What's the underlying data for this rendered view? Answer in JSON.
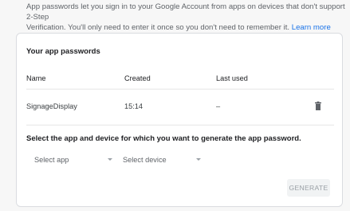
{
  "intro": {
    "line1": "App passwords let you sign in to your Google Account from apps on devices that don't support 2-Step",
    "line2": "Verification. You'll only need to enter it once so you don't need to remember it.",
    "link": "Learn more"
  },
  "card": {
    "title": "Your app passwords",
    "columns": {
      "name": "Name",
      "created": "Created",
      "last_used": "Last used"
    },
    "rows": [
      {
        "name": "SignageDisplay",
        "created": "15:14",
        "last_used": "–"
      }
    ],
    "generate_label": "Select the app and device for which you want to generate the app password.",
    "select_app": "Select app",
    "select_device": "Select device",
    "generate_button": "GENERATE"
  },
  "icons": {
    "delete": "trash-icon",
    "dropdown": "chevron-down-icon"
  },
  "colors": {
    "link": "#1a73e8",
    "disabled_button_bg": "#f1f3f4",
    "disabled_button_text": "#9aa0a6"
  }
}
